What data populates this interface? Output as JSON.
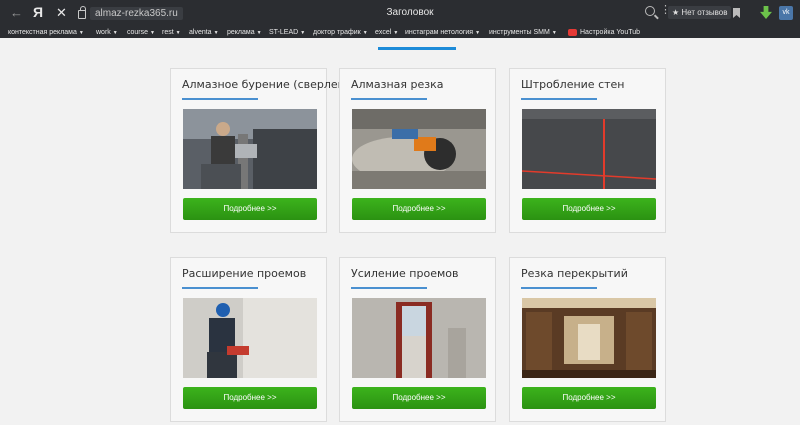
{
  "browser": {
    "ya_label": "Я",
    "url": "almaz-rezka365.ru",
    "page_title": "Заголовок",
    "reviews_label": "Нет отзывов"
  },
  "bookmarks": [
    {
      "label": "контекстная реклама",
      "has_menu": true
    },
    {
      "label": "work",
      "has_menu": true
    },
    {
      "label": "course",
      "has_menu": true
    },
    {
      "label": "rest",
      "has_menu": true
    },
    {
      "label": "alventa",
      "has_menu": true
    },
    {
      "label": "реклама",
      "has_menu": true
    },
    {
      "label": "ST-LEAD",
      "has_menu": true
    },
    {
      "label": "доктор трафик",
      "has_menu": true
    },
    {
      "label": "excel",
      "has_menu": true
    },
    {
      "label": "инстаграм нетология",
      "has_menu": true
    },
    {
      "label": "инструменты SMM",
      "has_menu": true
    },
    {
      "label": "Настройка YouTub",
      "has_menu": false
    }
  ],
  "services": [
    {
      "title": "Алмазное бурение (сверление)",
      "button": "Подробнее >>"
    },
    {
      "title": "Алмазная резка",
      "button": "Подробнее >>"
    },
    {
      "title": "Штробление стен",
      "button": "Подробнее >>"
    },
    {
      "title": "Расширение проемов",
      "button": "Подробнее >>"
    },
    {
      "title": "Усиление проемов",
      "button": "Подробнее >>"
    },
    {
      "title": "Резка перекрытий",
      "button": "Подробнее >>"
    }
  ]
}
